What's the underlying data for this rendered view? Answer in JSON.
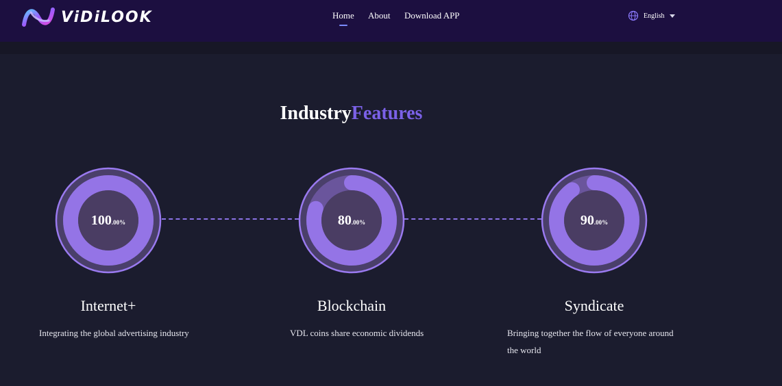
{
  "brand": {
    "name": "ViDiLOOK"
  },
  "nav": {
    "items": [
      {
        "label": "Home",
        "active": true
      },
      {
        "label": "About",
        "active": false
      },
      {
        "label": "Download APP",
        "active": false
      }
    ]
  },
  "language": {
    "label": "English",
    "icon": "globe-icon"
  },
  "section": {
    "title_white": "Industry",
    "title_purple": "Features"
  },
  "features": [
    {
      "value": "100",
      "decimal": ".00%",
      "progress": 1.0,
      "name": "Internet+",
      "description": "Integrating the global advertising industry"
    },
    {
      "value": "80",
      "decimal": ".00%",
      "progress": 0.8,
      "name": "Blockchain",
      "description": "VDL coins share economic dividends"
    },
    {
      "value": "90",
      "decimal": ".00%",
      "progress": 0.9,
      "name": "Syndicate",
      "description": "Bringing together the flow of everyone around the world"
    }
  ],
  "colors": {
    "header_bg": "#1c0f40",
    "page_bg": "#1b1c2e",
    "accent": "#7b61e8",
    "ring": "#9474e6",
    "ring_track": "#6a559c"
  }
}
